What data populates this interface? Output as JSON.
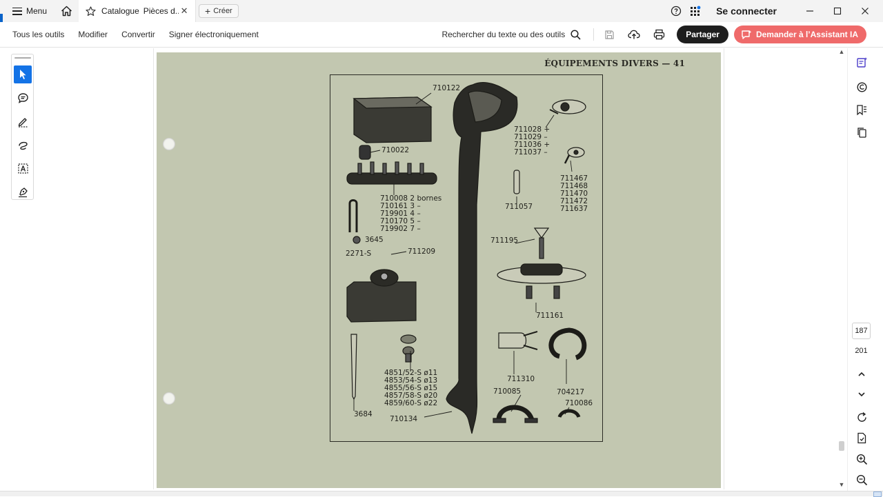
{
  "titlebar": {
    "menu_label": "Menu",
    "tab_title": "Catalogue",
    "tab_subtitle": "Pièces d...",
    "create_label": "Créer",
    "signin_label": "Se connecter"
  },
  "toolbar": {
    "items": [
      "Tous les outils",
      "Modifier",
      "Convertir",
      "Signer électroniquement"
    ],
    "search_label": "Rechercher du texte ou des outils",
    "share_label": "Partager",
    "ai_label": "Demander à l’Assistant IA"
  },
  "document": {
    "header": "ÉQUIPEMENTS DIVERS — 41",
    "parts": {
      "p710122": "710122",
      "p710022": "710022",
      "list_bornes": [
        "710008  2 bornes",
        "710161  3   –",
        "719901  4   –",
        "710170  5   –",
        "719902  7   –"
      ],
      "p3645": "3645",
      "p2271": "2271-S",
      "p711209": "711209",
      "list_washers": [
        "4851/52-S  ø11",
        "4853/54-S  ø13",
        "4855/56-S  ø15",
        "4857/58-S  ø20",
        "4859/60-S  ø22"
      ],
      "p3684": "3684",
      "p710134": "710134",
      "list_clamps": [
        "711028 +",
        "711029 –",
        "711036 +",
        "711037 –"
      ],
      "list_lugs": [
        "711467",
        "711468",
        "711470",
        "711472",
        "711637"
      ],
      "p711057": "711057",
      "p711195": "711195",
      "p711161": "711161",
      "p711310": "711310",
      "p704217": "704217",
      "p710085": "710085",
      "p710086": "710086"
    }
  },
  "navigation": {
    "current_page": "187",
    "total_pages": "201"
  },
  "colors": {
    "accent": "#1473e6",
    "share_bg": "#1e1e1e",
    "ai_bg": "#ef6a6a",
    "page_bg": "#c2c7b0"
  }
}
